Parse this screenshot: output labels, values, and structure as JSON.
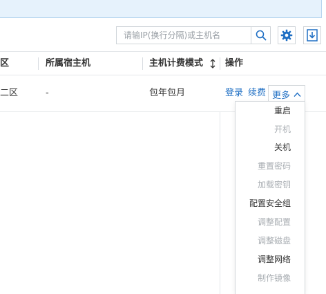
{
  "toolbar": {
    "search_placeholder": "请输IP(换行分隔)或主机名"
  },
  "table": {
    "headers": {
      "zone": "区",
      "host": "所属宿主机",
      "billing": "主机计费模式",
      "actions": "操作"
    },
    "row": {
      "zone": "二区",
      "host": "-",
      "billing": "包年包月",
      "login": "登录",
      "renew": "续费",
      "more": "更多"
    }
  },
  "more_menu": {
    "items": [
      {
        "label": "重启",
        "enabled": true
      },
      {
        "label": "开机",
        "enabled": false
      },
      {
        "label": "关机",
        "enabled": true
      },
      {
        "label": "重置密码",
        "enabled": false
      },
      {
        "label": "加载密钥",
        "enabled": false
      },
      {
        "label": "配置安全组",
        "enabled": true
      },
      {
        "label": "调整配置",
        "enabled": false
      },
      {
        "label": "调整磁盘",
        "enabled": false
      },
      {
        "label": "调整网络",
        "enabled": true
      },
      {
        "label": "制作镜像",
        "enabled": false
      }
    ]
  },
  "colors": {
    "link": "#1f6fc4",
    "banner_bg": "#e6f2fc",
    "disabled": "#a8adb2"
  }
}
